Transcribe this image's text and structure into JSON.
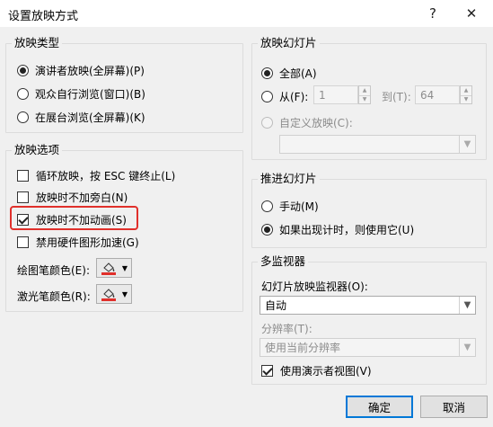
{
  "window": {
    "title": "设置放映方式",
    "help": "?",
    "close": "✕"
  },
  "show_type": {
    "title": "放映类型",
    "options": [
      {
        "label": "演讲者放映(全屏幕)(P)",
        "checked": true
      },
      {
        "label": "观众自行浏览(窗口)(B)",
        "checked": false
      },
      {
        "label": "在展台浏览(全屏幕)(K)",
        "checked": false
      }
    ]
  },
  "show_options": {
    "title": "放映选项",
    "loop": {
      "label": "循环放映，按 ESC 键终止(L)",
      "checked": false
    },
    "no_narration": {
      "label": "放映时不加旁白(N)",
      "checked": false
    },
    "no_animation": {
      "label": "放映时不加动画(S)",
      "checked": true
    },
    "disable_hw": {
      "label": "禁用硬件图形加速(G)",
      "checked": false
    },
    "pen_color": {
      "label": "绘图笔颜色(E):",
      "color": "#e0302b"
    },
    "laser_color": {
      "label": "激光笔颜色(R):",
      "color": "#e0302b"
    }
  },
  "show_slides": {
    "title": "放映幻灯片",
    "all": {
      "label": "全部(A)",
      "checked": true
    },
    "from": {
      "label": "从(F):",
      "checked": false,
      "value": "1"
    },
    "to": {
      "label": "到(T):",
      "value": "64"
    },
    "custom": {
      "label": "自定义放映(C):",
      "checked": false,
      "value": ""
    }
  },
  "advance": {
    "title": "推进幻灯片",
    "manual": {
      "label": "手动(M)",
      "checked": false
    },
    "timings": {
      "label": "如果出现计时，则使用它(U)",
      "checked": true
    }
  },
  "monitors": {
    "title": "多监视器",
    "monitor_label": "幻灯片放映监视器(O):",
    "monitor_value": "自动",
    "resolution_label": "分辨率(T):",
    "resolution_value": "使用当前分辨率",
    "presenter_view": {
      "label": "使用演示者视图(V)",
      "checked": true
    }
  },
  "buttons": {
    "ok": "确定",
    "cancel": "取消"
  }
}
